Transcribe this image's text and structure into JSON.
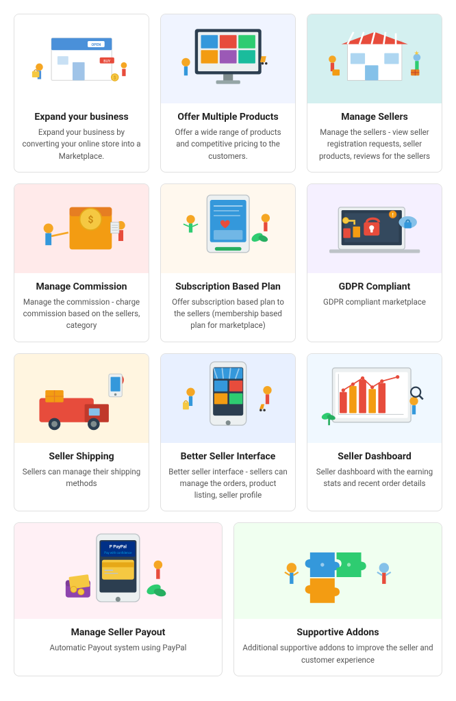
{
  "cards": [
    {
      "id": "expand",
      "title": "Expand your business",
      "desc": "Expand your business by converting your online store into a Marketplace.",
      "imgClass": "img-expand"
    },
    {
      "id": "products",
      "title": "Offer Multiple Products",
      "desc": "Offer a wide range of products and competitive pricing to the customers.",
      "imgClass": "img-products"
    },
    {
      "id": "sellers",
      "title": "Manage Sellers",
      "desc": "Manage the sellers - view seller registration requests, seller products, reviews for the sellers",
      "imgClass": "img-sellers"
    },
    {
      "id": "commission",
      "title": "Manage Commission",
      "desc": "Manage the commission - charge commission based on the sellers, category",
      "imgClass": "img-commission"
    },
    {
      "id": "subscription",
      "title": "Subscription Based Plan",
      "desc": "Offer subscription based plan to the sellers (membership based plan for marketplace)",
      "imgClass": "img-subscription"
    },
    {
      "id": "gdpr",
      "title": "GDPR Compliant",
      "desc": "GDPR compliant marketplace",
      "imgClass": "img-gdpr"
    },
    {
      "id": "shipping",
      "title": "Seller Shipping",
      "desc": "Sellers can manage their shipping methods",
      "imgClass": "img-shipping"
    },
    {
      "id": "interface",
      "title": "Better Seller Interface",
      "desc": "Better seller interface - sellers can manage the orders, product listing, seller profile",
      "imgClass": "img-interface"
    },
    {
      "id": "dashboard",
      "title": "Seller Dashboard",
      "desc": "Seller dashboard with the earning stats and recent order details",
      "imgClass": "img-dashboard"
    },
    {
      "id": "payout",
      "title": "Manage Seller Payout",
      "desc": "Automatic Payout system using PayPal",
      "imgClass": "img-payout"
    },
    {
      "id": "addons",
      "title": "Supportive Addons",
      "desc": "Additional supportive addons to improve the seller and customer experience",
      "imgClass": "img-addons"
    }
  ]
}
